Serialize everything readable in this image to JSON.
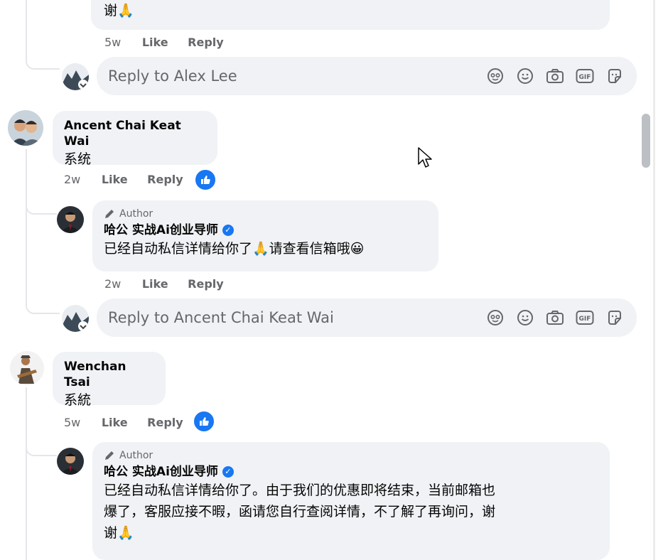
{
  "prev_comment": {
    "text_tail": "谢🙏",
    "time": "5w",
    "like_label": "Like",
    "reply_label": "Reply"
  },
  "reply_box_1": {
    "placeholder": "Reply to Alex Lee"
  },
  "comment_1": {
    "name": "Ancent Chai Keat Wai",
    "text": "系统",
    "time": "2w",
    "like_label": "Like",
    "reply_label": "Reply",
    "reply": {
      "author_tag": "Author",
      "name": "哈公 实战Ai创业导师",
      "text": "已经自动私信详情给你了🙏请查看信箱哦😀",
      "time": "2w",
      "like_label": "Like",
      "reply_label": "Reply"
    }
  },
  "reply_box_2": {
    "placeholder": "Reply to Ancent Chai Keat Wai"
  },
  "comment_2": {
    "name": "Wenchan Tsai",
    "text": "系統",
    "time": "5w",
    "like_label": "Like",
    "reply_label": "Reply",
    "reply": {
      "author_tag": "Author",
      "name": "哈公 实战Ai创业导师",
      "line1": "已经自动私信详情给你了。由于我们的优惠即将结束，当前邮箱也",
      "line2": "爆了，客服应接不暇，函请您自行查阅详情，不了解了再询问，谢",
      "line3": "谢🙏"
    }
  },
  "reply_icons": [
    "avatar-sticker-icon",
    "emoji-icon",
    "camera-icon",
    "gif-icon",
    "sticker-icon"
  ],
  "colors": {
    "bubble": "#f0f2f5",
    "accent": "#1877f2",
    "meta": "#65676b"
  }
}
